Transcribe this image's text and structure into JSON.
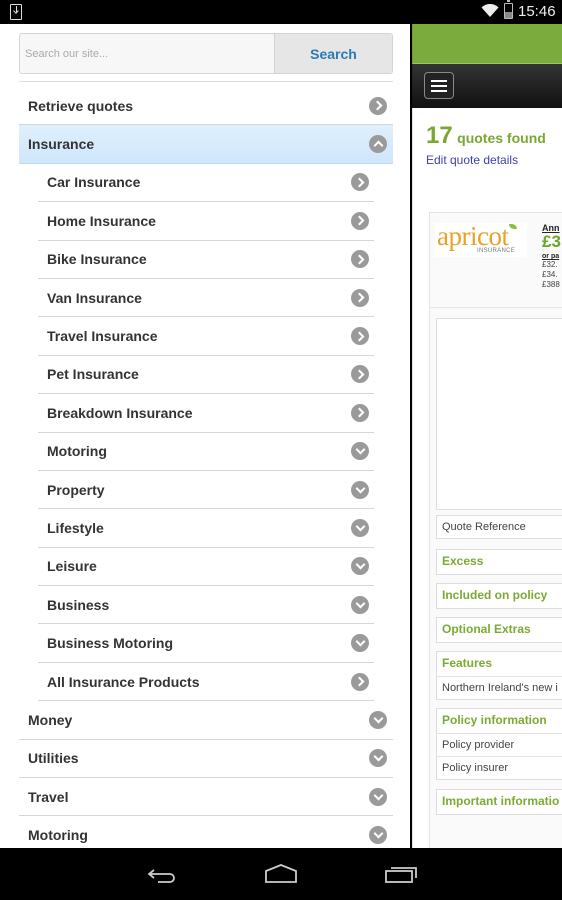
{
  "status_bar": {
    "time": "15:46",
    "icons": [
      "download-notification-icon",
      "wifi-icon",
      "battery-charging-icon"
    ]
  },
  "drawer": {
    "search": {
      "placeholder": "Search our site...",
      "value": "",
      "button_label": "Search"
    },
    "menu": [
      {
        "label": "Retrieve quotes",
        "level": 0,
        "icon": "chevron-right-icon",
        "active": false
      },
      {
        "label": "Insurance",
        "level": 0,
        "icon": "chevron-up-icon",
        "active": true
      },
      {
        "label": "Car Insurance",
        "level": 1,
        "icon": "chevron-right-icon",
        "active": false
      },
      {
        "label": "Home Insurance",
        "level": 1,
        "icon": "chevron-right-icon",
        "active": false
      },
      {
        "label": "Bike Insurance",
        "level": 1,
        "icon": "chevron-right-icon",
        "active": false
      },
      {
        "label": "Van Insurance",
        "level": 1,
        "icon": "chevron-right-icon",
        "active": false
      },
      {
        "label": "Travel Insurance",
        "level": 1,
        "icon": "chevron-right-icon",
        "active": false
      },
      {
        "label": "Pet Insurance",
        "level": 1,
        "icon": "chevron-right-icon",
        "active": false
      },
      {
        "label": "Breakdown Insurance",
        "level": 1,
        "icon": "chevron-right-icon",
        "active": false
      },
      {
        "label": "Motoring",
        "level": 1,
        "icon": "chevron-down-icon",
        "active": false
      },
      {
        "label": "Property",
        "level": 1,
        "icon": "chevron-down-icon",
        "active": false
      },
      {
        "label": "Lifestyle",
        "level": 1,
        "icon": "chevron-down-icon",
        "active": false
      },
      {
        "label": "Leisure",
        "level": 1,
        "icon": "chevron-down-icon",
        "active": false
      },
      {
        "label": "Business",
        "level": 1,
        "icon": "chevron-down-icon",
        "active": false
      },
      {
        "label": "Business Motoring",
        "level": 1,
        "icon": "chevron-down-icon",
        "active": false
      },
      {
        "label": "All Insurance Products",
        "level": 1,
        "icon": "chevron-right-icon",
        "active": false
      },
      {
        "label": "Money",
        "level": 0,
        "icon": "chevron-down-icon",
        "active": false
      },
      {
        "label": "Utilities",
        "level": 0,
        "icon": "chevron-down-icon",
        "active": false
      },
      {
        "label": "Travel",
        "level": 0,
        "icon": "chevron-down-icon",
        "active": false
      },
      {
        "label": "Motoring",
        "level": 0,
        "icon": "chevron-down-icon",
        "active": false
      }
    ]
  },
  "page": {
    "colors": {
      "brand_green": "#7cab3d",
      "heading_green": "#78a832",
      "link_blue": "#3f3fae"
    },
    "quotes_count": "17",
    "quotes_text": "quotes found",
    "edit_link": "Edit quote details",
    "result": {
      "provider_logo_text": "apricot",
      "provider_logo_subtext": "INSURANCE",
      "price_label": "Ann",
      "price_main": "£3",
      "price_or": "or pa",
      "price_lines": [
        "£32.",
        "£34.",
        "£388"
      ],
      "quote_reference_label": "Quote Reference",
      "sections": [
        {
          "title": "Excess",
          "rows": []
        },
        {
          "title": "Included on policy",
          "rows": []
        },
        {
          "title": "Optional Extras",
          "rows": []
        },
        {
          "title": "Features",
          "rows": [
            "Northern Ireland's new i"
          ]
        },
        {
          "title": "Policy information",
          "rows": [
            "Policy provider",
            "Policy insurer"
          ]
        },
        {
          "title": "Important informatio",
          "rows": []
        }
      ]
    }
  },
  "nav_bar": {
    "buttons": [
      "back-icon",
      "home-icon",
      "recents-icon"
    ]
  }
}
